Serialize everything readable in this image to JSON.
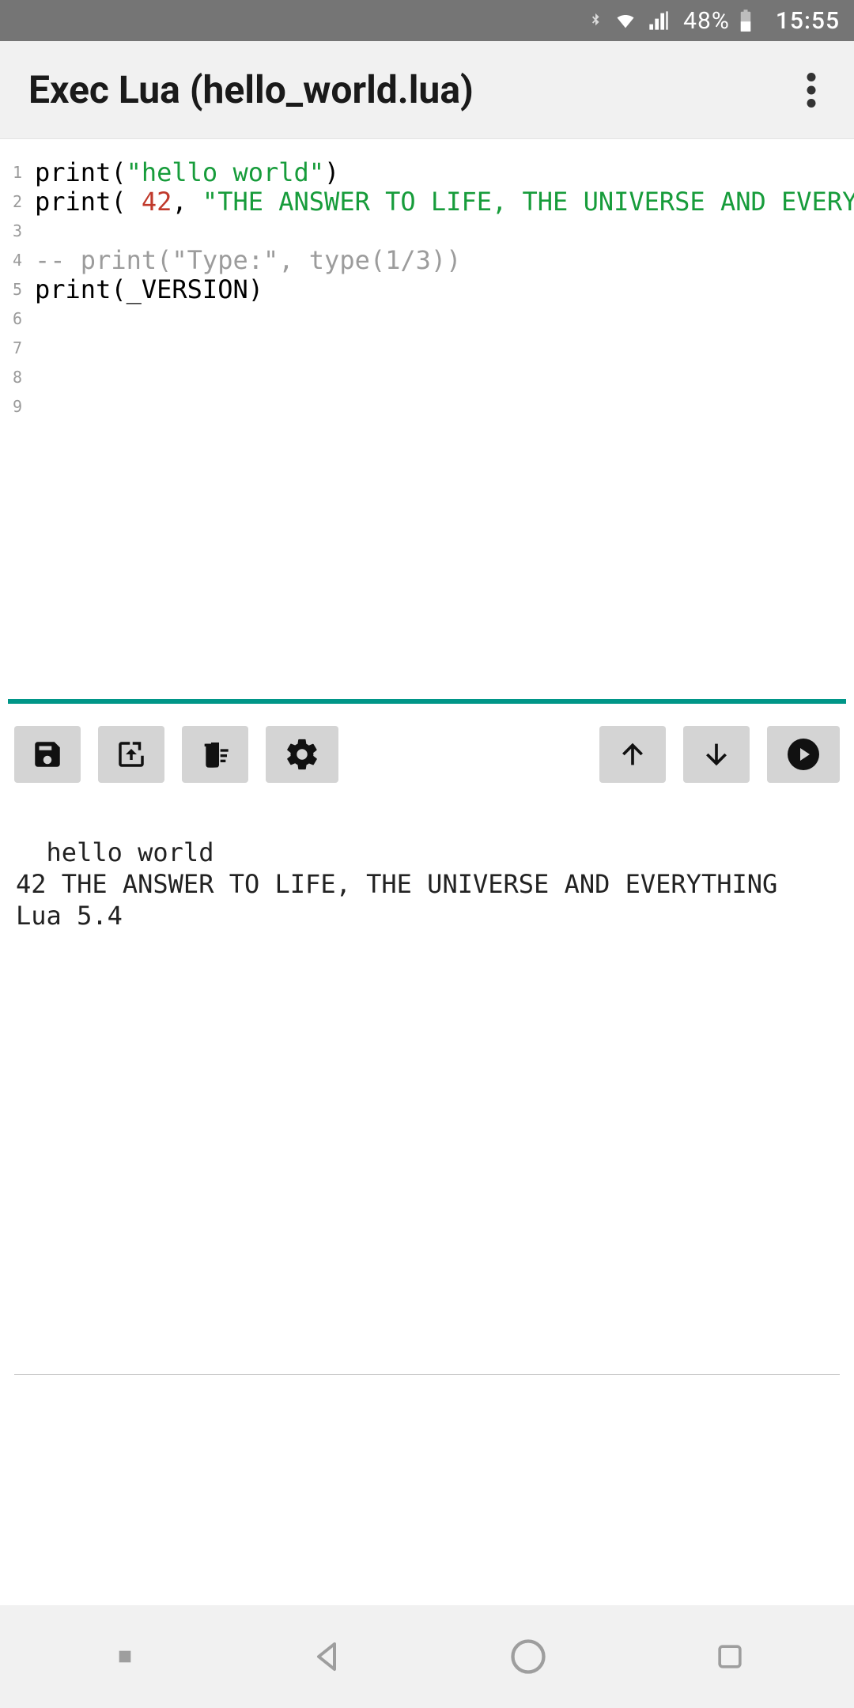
{
  "status": {
    "bluetooth_icon": "bluetooth",
    "wifi_icon": "wifi",
    "signal_icon": "signal",
    "battery_percent": "48%",
    "battery_icon": "battery",
    "time": "15:55"
  },
  "appbar": {
    "title": "Exec Lua (hello_world.lua)",
    "more_icon": "more-vert"
  },
  "editor": {
    "line_count": 9,
    "lines": [
      {
        "n": "1",
        "tokens": [
          {
            "t": "print",
            "c": "fn"
          },
          {
            "t": "(",
            "c": "punc"
          },
          {
            "t": "\"hello world\"",
            "c": "str"
          },
          {
            "t": ")",
            "c": "punc"
          }
        ]
      },
      {
        "n": "2",
        "tokens": [
          {
            "t": "print",
            "c": "fn"
          },
          {
            "t": "( ",
            "c": "punc"
          },
          {
            "t": "42",
            "c": "num"
          },
          {
            "t": ", ",
            "c": "punc"
          },
          {
            "t": "\"THE ANSWER TO LIFE, THE UNIVERSE AND EVERYTHING\"",
            "c": "str"
          },
          {
            "t": ")",
            "c": "punc"
          }
        ]
      },
      {
        "n": "3",
        "tokens": []
      },
      {
        "n": "4",
        "tokens": [
          {
            "t": "-- print(\"Type:\", type(1/3))",
            "c": "comment"
          }
        ]
      },
      {
        "n": "5",
        "tokens": [
          {
            "t": "print",
            "c": "fn"
          },
          {
            "t": "(",
            "c": "punc"
          },
          {
            "t": "_VERSION",
            "c": "global"
          },
          {
            "t": ")",
            "c": "punc"
          }
        ]
      },
      {
        "n": "6",
        "tokens": []
      },
      {
        "n": "7",
        "tokens": []
      },
      {
        "n": "8",
        "tokens": []
      },
      {
        "n": "9",
        "tokens": []
      }
    ]
  },
  "toolbar": {
    "save_icon": "save",
    "open_icon": "open-in-new",
    "clear_icon": "clear-all",
    "settings_icon": "settings",
    "up_icon": "arrow-up",
    "down_icon": "arrow-down",
    "run_icon": "play-circle"
  },
  "output": {
    "text": "hello world\n42 THE ANSWER TO LIFE, THE UNIVERSE AND EVERYTHING\nLua 5.4"
  },
  "nav": {
    "recent_icon": "recent-small-square",
    "back_icon": "back-triangle",
    "home_icon": "home-circle",
    "overview_icon": "overview-square"
  },
  "colors": {
    "accent": "#009688",
    "string": "#179c3b",
    "number": "#c0392b",
    "comment": "#9c9c9c",
    "statusbar": "#757575",
    "btn_bg": "#d4d4d4"
  }
}
